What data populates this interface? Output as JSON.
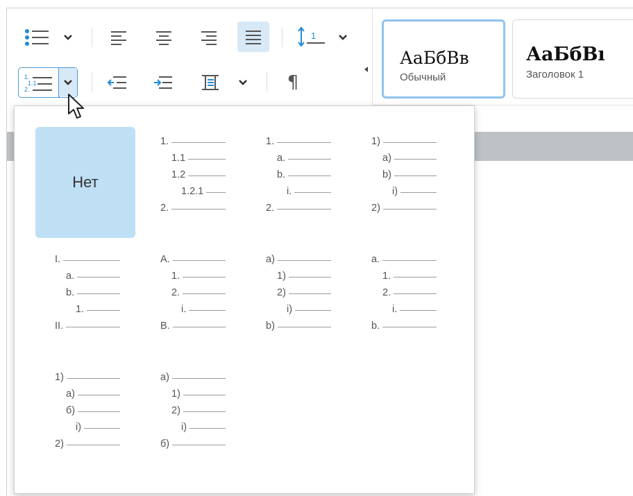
{
  "toolbar": {
    "paragraph_mark": "¶",
    "multilevel_list_icon_text": [
      "1.",
      "1.1",
      "2."
    ],
    "line_spacing_icon_text": "1"
  },
  "styles": [
    {
      "sample": "АаБбВв",
      "name": "Обычный",
      "selected": true
    },
    {
      "sample": "АаБбВı",
      "name": "Заголовок 1",
      "selected": false
    }
  ],
  "list_presets": {
    "none_label": "Нет",
    "presets": [
      {
        "lines": [
          "1.",
          "1.1",
          "1.2",
          "1.2.1",
          "2."
        ]
      },
      {
        "lines": [
          "1.",
          "a.",
          "b.",
          "i.",
          "2."
        ]
      },
      {
        "lines": [
          "1)",
          "a)",
          "b)",
          "i)",
          "2)"
        ]
      },
      {
        "lines": [
          "I.",
          "a.",
          "b.",
          "1.",
          "II."
        ]
      },
      {
        "lines": [
          "A.",
          "1.",
          "2.",
          "i.",
          "B."
        ]
      },
      {
        "lines": [
          "a)",
          "1)",
          "2)",
          "i)",
          "b)"
        ]
      },
      {
        "lines": [
          "a.",
          "1.",
          "2.",
          "i.",
          "b."
        ]
      },
      {
        "lines": [
          "1)",
          "a)",
          "б)",
          "i)",
          "2)"
        ]
      },
      {
        "lines": [
          "a)",
          "1)",
          "2)",
          "i)",
          "б)"
        ]
      }
    ]
  },
  "colors": {
    "accent": "#4a9ad8",
    "selected_fill": "#bfdff5",
    "active_button": "#d7e8f7",
    "doc_band": "#bfc2c4"
  }
}
